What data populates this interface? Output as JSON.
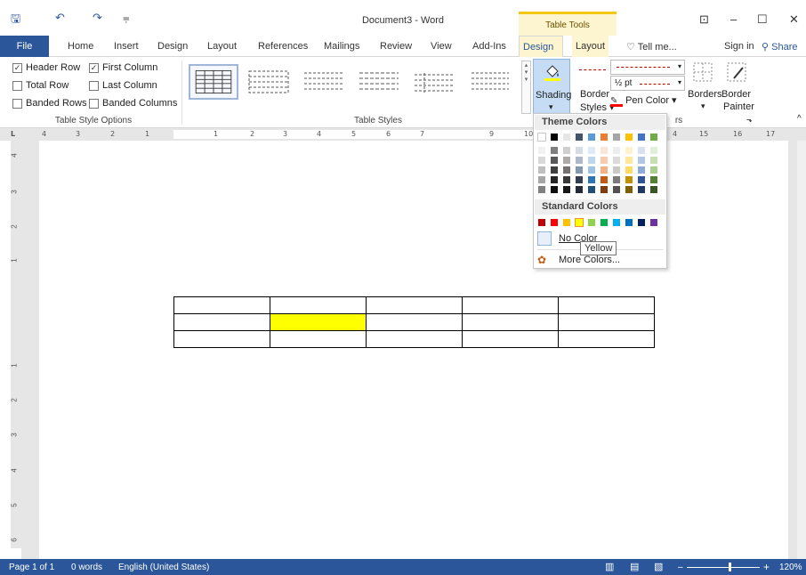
{
  "window": {
    "title": "Document3 - Word",
    "context_tab_header": "Table Tools",
    "minimize": "–",
    "maximize": "☐",
    "close": "✕",
    "ribbon_display": "⊡"
  },
  "qat": {
    "save": "🖫",
    "undo": "↶",
    "redo": "↷",
    "customize": "⩦"
  },
  "tabs": {
    "file": "File",
    "home": "Home",
    "insert": "Insert",
    "design": "Design",
    "layout": "Layout",
    "references": "References",
    "mailings": "Mailings",
    "review": "Review",
    "view": "View",
    "addins": "Add-Ins",
    "table_design": "Design",
    "table_layout": "Layout",
    "tell_me": "Tell me...",
    "sign_in": "Sign in",
    "share": "Share"
  },
  "table_style_options": {
    "header_row": "Header Row",
    "first_column": "First Column",
    "total_row": "Total Row",
    "last_column": "Last Column",
    "banded_rows": "Banded Rows",
    "banded_columns": "Banded Columns",
    "check_mark": "✓",
    "group_label": "Table Style Options"
  },
  "table_styles": {
    "group_label": "Table Styles"
  },
  "shading": {
    "label": "Shading",
    "arrow": "▾"
  },
  "borders_group": {
    "border_styles_label1": "Border",
    "border_styles_label2": "Styles",
    "pen_weight": "½ pt",
    "pen_color": "Pen Color",
    "borders": "Borders",
    "border_painter1": "Border",
    "border_painter2": "Painter",
    "group_label_tail": "rs"
  },
  "ruler": {
    "h": [
      "4",
      "3",
      "2",
      "1",
      "1",
      "2",
      "3",
      "4",
      "5",
      "6",
      "7",
      "9",
      "10",
      "4",
      "15",
      "16",
      "17"
    ],
    "v": [
      "4",
      "3",
      "2",
      "1",
      "1",
      "2",
      "3",
      "4",
      "5",
      "6",
      "7"
    ]
  },
  "dropdown": {
    "theme_colors_label": "Theme Colors",
    "standard_colors_label": "Standard Colors",
    "no_color": "No Color",
    "more_colors": "More Colors...",
    "tooltip": "Yellow",
    "theme_top": [
      "#ffffff",
      "#000000",
      "#e7e6e6",
      "#44546a",
      "#5b9bd5",
      "#ed7d31",
      "#a5a5a5",
      "#ffc000",
      "#4472c4",
      "#70ad47"
    ],
    "theme_shades": [
      [
        "#f2f2f2",
        "#7f7f7f",
        "#d0cece",
        "#d6dce4",
        "#ddebf7",
        "#fbe5d6",
        "#ededed",
        "#fff2cc",
        "#d9e2f3",
        "#e2efda"
      ],
      [
        "#d9d9d9",
        "#595959",
        "#aeaaaa",
        "#adb9ca",
        "#bdd7ee",
        "#f8cbad",
        "#dbdbdb",
        "#ffe699",
        "#b4c6e7",
        "#c6e0b4"
      ],
      [
        "#bfbfbf",
        "#404040",
        "#757171",
        "#8497b0",
        "#9dc3e6",
        "#f4b183",
        "#c9c9c9",
        "#ffd966",
        "#8eaadb",
        "#a9d08e"
      ],
      [
        "#a6a6a6",
        "#262626",
        "#3a3838",
        "#333f4f",
        "#2e75b6",
        "#c55a11",
        "#7b7b7b",
        "#bf9000",
        "#2f5597",
        "#548235"
      ],
      [
        "#808080",
        "#0d0d0d",
        "#171616",
        "#222a35",
        "#1f4e79",
        "#833c0b",
        "#525252",
        "#7f6000",
        "#1f3864",
        "#375623"
      ]
    ],
    "standard": [
      "#c00000",
      "#ff0000",
      "#ffc000",
      "#ffff00",
      "#92d050",
      "#00b050",
      "#00b0f0",
      "#0070c0",
      "#002060",
      "#7030a0"
    ]
  },
  "document": {
    "table_rows": 3,
    "table_cols": 5,
    "highlight_color": "#ffff00"
  },
  "status": {
    "page": "Page 1 of 1",
    "words": "0 words",
    "language": "English (United States)",
    "zoom": "120%"
  },
  "colors": {
    "word_blue": "#2b579a",
    "context_tab": "#fcf5d0",
    "shading_active": "#c5dcf4"
  }
}
